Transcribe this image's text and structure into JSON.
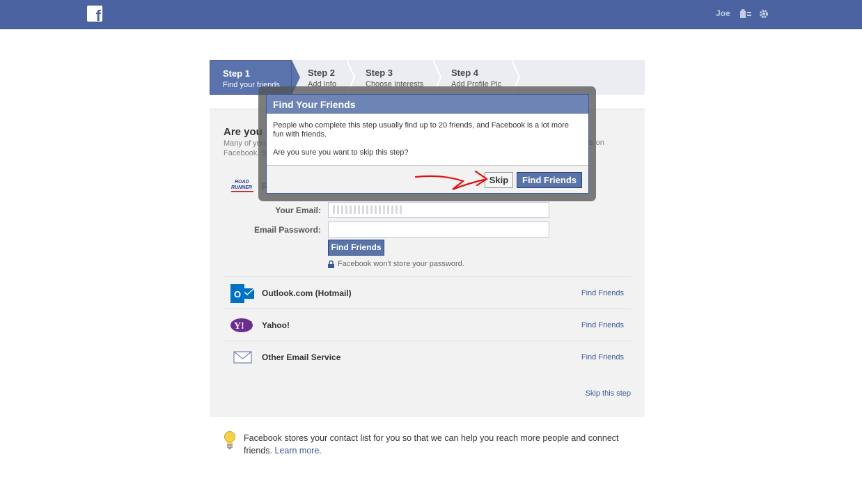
{
  "topbar": {
    "user_name": "Joe",
    "colors": {
      "bar": "#4b64a1"
    }
  },
  "wizard": {
    "steps": [
      {
        "title": "Step 1",
        "subtitle": "Find your friends"
      },
      {
        "title": "Step 2",
        "subtitle": "Add Info"
      },
      {
        "title": "Step 3",
        "subtitle": "Choose Interests"
      },
      {
        "title": "Step 4",
        "subtitle": "Add Profile Pic"
      }
    ]
  },
  "main": {
    "heading": "Are you",
    "intro_left": "Many of you",
    "intro_left2": "Facebook. S",
    "intro_right": "ds on",
    "provider_label": "R",
    "email_label": "Your Email:",
    "password_label": "Email Password:",
    "find_friends_button": "Find Friends",
    "password_note": "Facebook won't store your password.",
    "providers": [
      {
        "name": "Outlook.com (Hotmail)",
        "link": "Find Friends",
        "icon": "outlook-icon"
      },
      {
        "name": "Yahoo!",
        "link": "Find Friends",
        "icon": "yahoo-icon"
      },
      {
        "name": "Other Email Service",
        "link": "Find Friends",
        "icon": "envelope-icon"
      }
    ],
    "skip_step": "Skip this step"
  },
  "tip": {
    "text": "Facebook stores your contact list for you so that we can help you reach more people and connect friends.",
    "learn_more": "Learn more."
  },
  "dialog": {
    "title": "Find Your Friends",
    "body": "People who complete this step usually find up to 20 friends, and Facebook is a lot more fun with friends.",
    "question": "Are you sure you want to skip this step?",
    "skip_button": "Skip",
    "find_friends_button": "Find Friends"
  }
}
